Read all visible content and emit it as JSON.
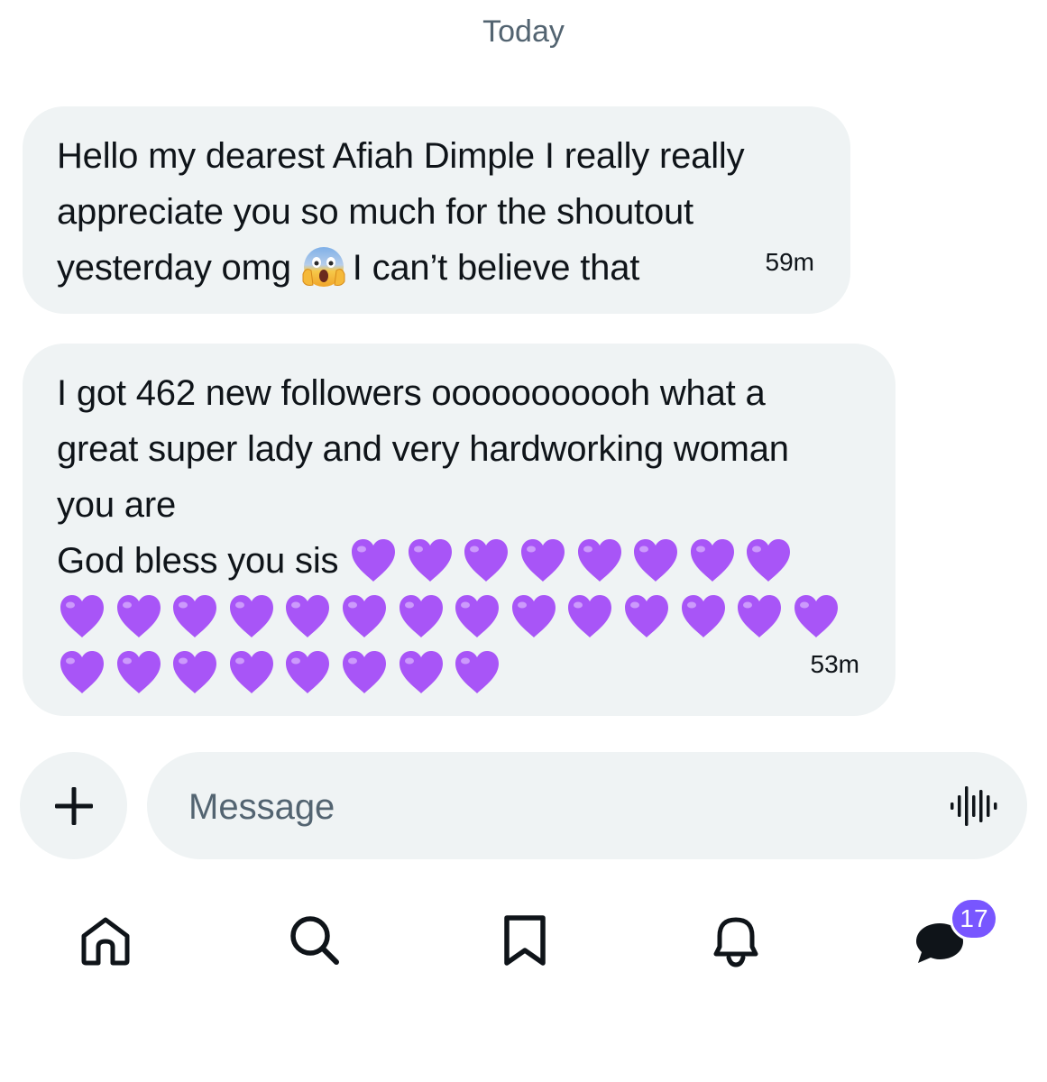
{
  "thread": {
    "day_label": "Today",
    "messages": [
      {
        "text_before_emoji": "Hello my dearest Afiah Dimple I really really\nappreciate you so much for the shoutout\nyesterday omg",
        "emoji": "face-screaming-in-fear",
        "text_after_emoji": "I can’t believe that",
        "time": "59m"
      },
      {
        "text": "I got 462 new followers ooooooooooh what a\ngreat super lady and very hardworking woman\nyou are\nGod bless you sis",
        "emoji": "purple-heart",
        "heart_count": 30,
        "time": "53m"
      }
    ]
  },
  "composer": {
    "add_icon": "plus-icon",
    "placeholder": "Message",
    "voice_icon": "voice-waveform-icon"
  },
  "tabbar": {
    "items": [
      {
        "name": "home",
        "icon": "home-icon"
      },
      {
        "name": "search",
        "icon": "search-icon"
      },
      {
        "name": "bookmarks",
        "icon": "bookmark-icon"
      },
      {
        "name": "notifications",
        "icon": "bell-icon"
      },
      {
        "name": "messages",
        "icon": "messages-icon"
      }
    ],
    "messages_badge": "17"
  },
  "colors": {
    "bubble": "#eff3f4",
    "text": "#0f1419",
    "secondary_text": "#536471",
    "heart": "#a855f7",
    "badge": "#7856ff"
  }
}
